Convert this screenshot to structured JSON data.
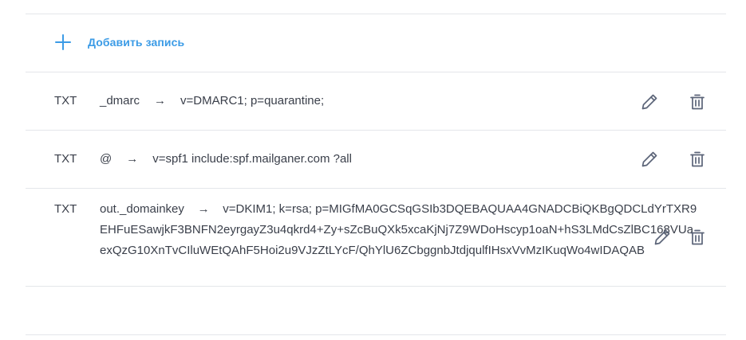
{
  "add_record": {
    "label": "Добавить запись",
    "icon": "plus-icon",
    "color": "#3b9be6"
  },
  "arrow_glyph": "→",
  "records": [
    {
      "type": "TXT",
      "name": "_dmarc",
      "value": "v=DMARC1; p=quarantine;"
    },
    {
      "type": "TXT",
      "name": "@",
      "value": "v=spf1 include:spf.mailganer.com ?all"
    },
    {
      "type": "TXT",
      "name": "out._domainkey",
      "value": "v=DKIM1; k=rsa; p=MIGfMA0GCSqGSIb3DQEBAQUAA4GNADCBiQKBgQDCLdYrTXR9EHFuESawjkF3BNFN2eyrgayZ3u4qkrd4+Zy+sZcBuQXk5xcaKjNj7Z9WDoHscyp1oaN+hS3LMdCsZlBC168VUaexQzG10XnTvCIluWEtQAhF5Hoi2u9VJzZtLYcF/QhYlU6ZCbggnbJtdjqulfIHsxVvMzIKuqWo4wIDAQAB"
    }
  ],
  "actions": {
    "edit_icon": "pencil-icon",
    "delete_icon": "trash-icon",
    "icon_color": "#5b6478"
  }
}
